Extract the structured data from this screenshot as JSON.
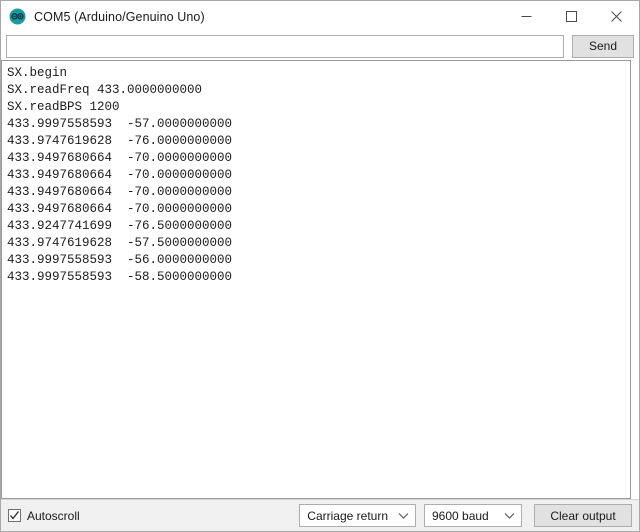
{
  "window": {
    "title": "COM5 (Arduino/Genuino Uno)",
    "icon": "arduino-logo-icon",
    "controls": {
      "minimize": "minimize-icon",
      "maximize": "maximize-icon",
      "close": "close-icon"
    }
  },
  "send_row": {
    "input_value": "",
    "input_placeholder": "",
    "send_label": "Send"
  },
  "output": {
    "lines": [
      "SX.begin",
      "SX.readFreq 433.0000000000",
      "SX.readBPS 1200",
      "433.9997558593  -57.0000000000",
      "433.9747619628  -76.0000000000",
      "433.9497680664  -70.0000000000",
      "433.9497680664  -70.0000000000",
      "433.9497680664  -70.0000000000",
      "433.9497680664  -70.0000000000",
      "433.9247741699  -76.5000000000",
      "433.9747619628  -57.5000000000",
      "433.9997558593  -56.0000000000",
      "433.9997558593  -58.5000000000"
    ],
    "text": "SX.begin\nSX.readFreq 433.0000000000\nSX.readBPS 1200\n433.9997558593  -57.0000000000\n433.9747619628  -76.0000000000\n433.9497680664  -70.0000000000\n433.9497680664  -70.0000000000\n433.9497680664  -70.0000000000\n433.9497680664  -70.0000000000\n433.9247741699  -76.5000000000\n433.9747619628  -57.5000000000\n433.9997558593  -56.0000000000\n433.9997558593  -58.5000000000"
  },
  "status_bar": {
    "autoscroll_label": "Autoscroll",
    "autoscroll_checked": true,
    "line_ending_value": "Carriage return",
    "baud_value": "9600 baud",
    "clear_output_label": "Clear output"
  },
  "colors": {
    "accent": "#00979c",
    "window_bg": "#ffffff",
    "statusbar_bg": "#f0f0f0",
    "button_bg": "#e1e1e1",
    "border": "#a8a8a8",
    "text": "#1a1a1a"
  }
}
